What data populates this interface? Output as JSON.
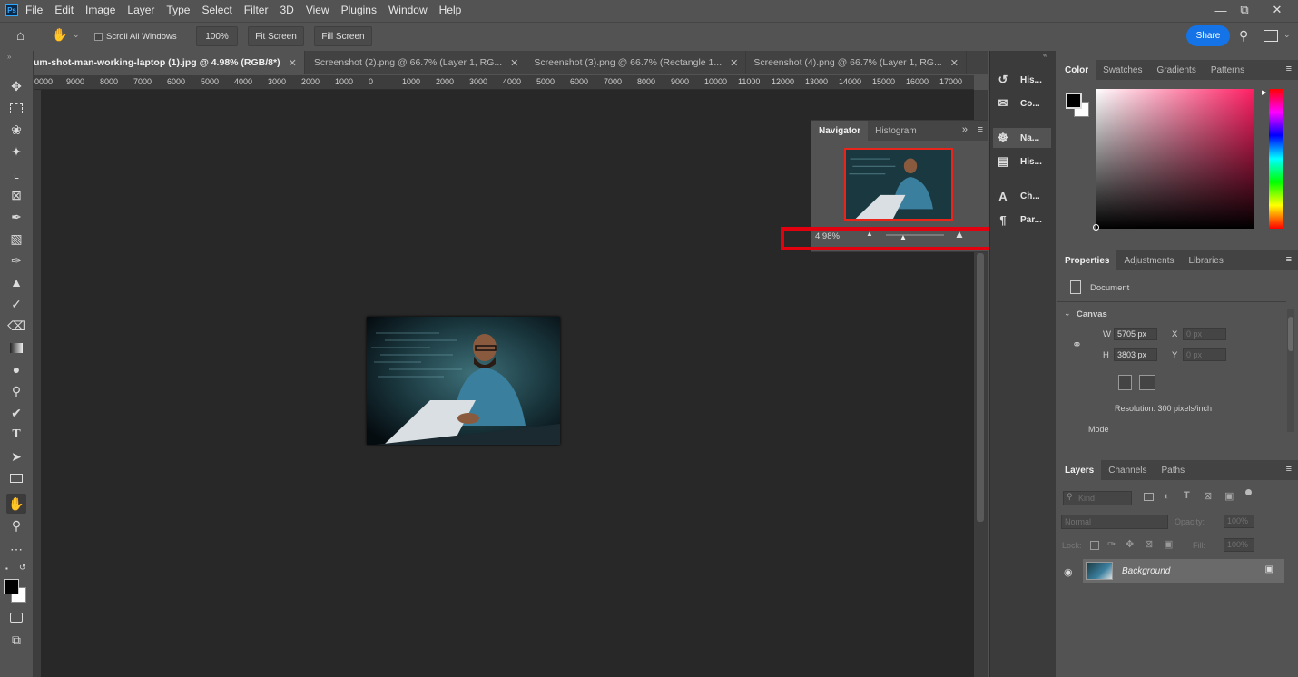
{
  "app": {
    "logo": "Ps"
  },
  "menu": [
    "File",
    "Edit",
    "Image",
    "Layer",
    "Type",
    "Select",
    "Filter",
    "3D",
    "View",
    "Plugins",
    "Window",
    "Help"
  ],
  "options_bar": {
    "scroll_all_windows": "Scroll All Windows",
    "zoom_100": "100%",
    "fit_screen": "Fit Screen",
    "fill_screen": "Fill Screen",
    "share": "Share"
  },
  "tabs": [
    {
      "label": "um-shot-man-working-laptop (1).jpg @ 4.98% (RGB/8*)",
      "active": true
    },
    {
      "label": "Screenshot (2).png @ 66.7% (Layer 1, RG...",
      "active": false
    },
    {
      "label": "Screenshot (3).png @ 66.7% (Rectangle 1...",
      "active": false
    },
    {
      "label": "Screenshot (4).png @ 66.7% (Layer 1, RG...",
      "active": false
    }
  ],
  "ruler_labels": [
    "0000",
    "9000",
    "8000",
    "7000",
    "6000",
    "5000",
    "4000",
    "3000",
    "2000",
    "1000",
    "0",
    "1000",
    "2000",
    "3000",
    "4000",
    "5000",
    "6000",
    "7000",
    "8000",
    "9000",
    "10000",
    "11000",
    "12000",
    "13000",
    "14000",
    "15000",
    "16000",
    "17000"
  ],
  "navigator": {
    "tabs": [
      "Navigator",
      "Histogram"
    ],
    "zoom": "4.98%"
  },
  "icon_strip": [
    "His...",
    "Co...",
    "Na...",
    "His...",
    "Ch...",
    "Par..."
  ],
  "color_panel": {
    "tabs": [
      "Color",
      "Swatches",
      "Gradients",
      "Patterns"
    ]
  },
  "properties_panel": {
    "tabs": [
      "Properties",
      "Adjustments",
      "Libraries"
    ],
    "document_label": "Document",
    "canvas_label": "Canvas",
    "w_label": "W",
    "w_value": "5705 px",
    "h_label": "H",
    "h_value": "3803 px",
    "x_label": "X",
    "x_placeholder": "0 px",
    "y_label": "Y",
    "y_placeholder": "0 px",
    "resolution": "Resolution: 300 pixels/inch",
    "mode_label": "Mode"
  },
  "layers_panel": {
    "tabs": [
      "Layers",
      "Channels",
      "Paths"
    ],
    "kind_placeholder": "Kind",
    "blend_mode": "Normal",
    "opacity_label": "Opacity:",
    "opacity_value": "100%",
    "lock_label": "Lock:",
    "fill_label": "Fill:",
    "fill_value": "100%",
    "layer_name": "Background"
  },
  "colors": {
    "accent": "#1473e6",
    "highlight": "#e3000f",
    "navbox": "#e8241b"
  }
}
